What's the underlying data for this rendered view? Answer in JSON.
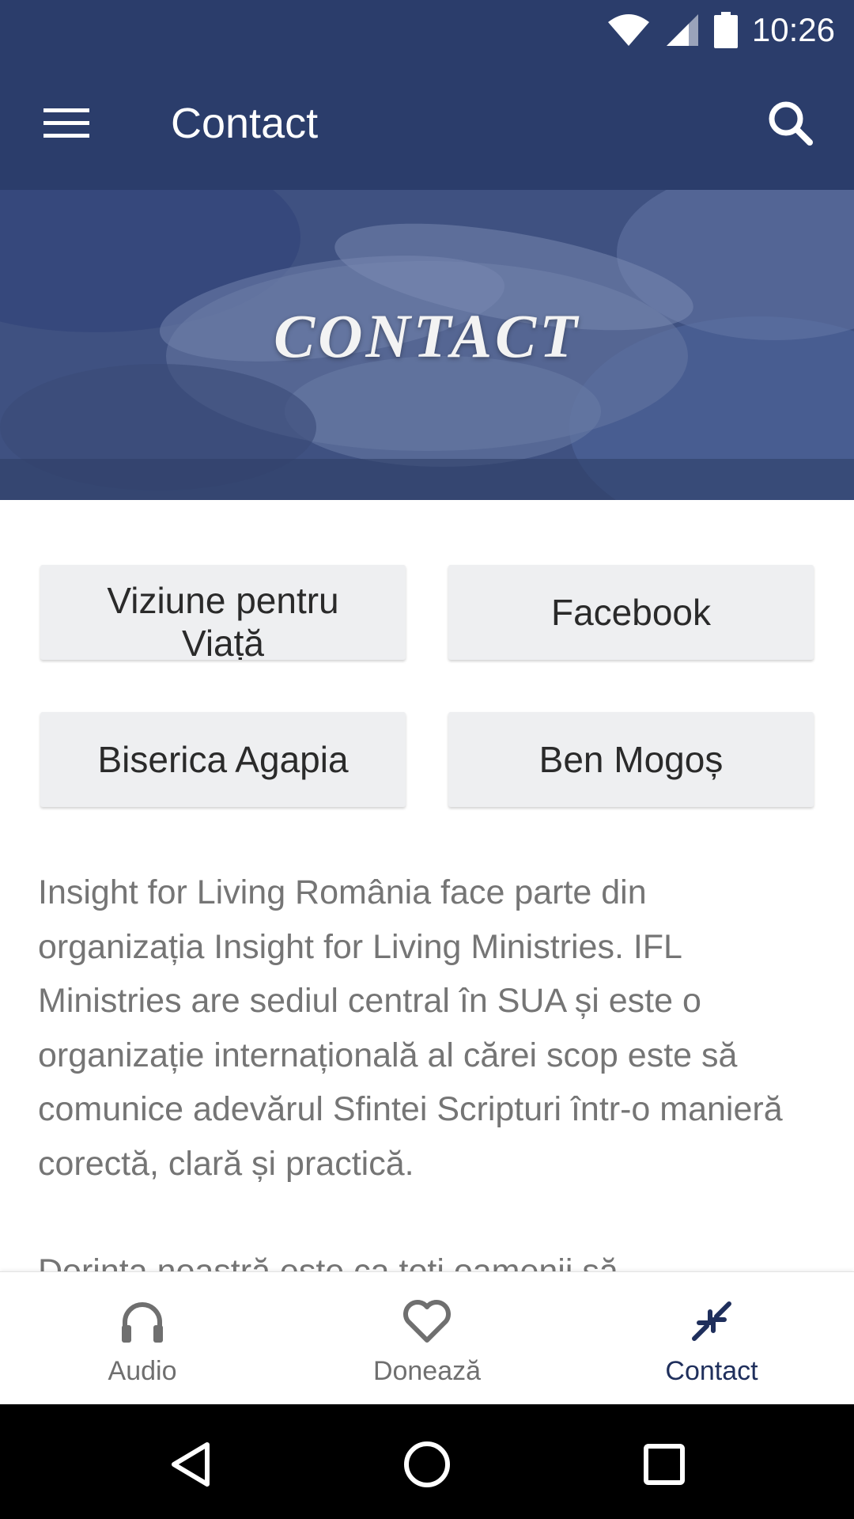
{
  "status_bar": {
    "time": "10:26"
  },
  "app_bar": {
    "title": "Contact"
  },
  "hero": {
    "title": "CONTACT"
  },
  "link_buttons": [
    {
      "label": "Viziune pentru Viață"
    },
    {
      "label": "Facebook"
    },
    {
      "label": "Biserica Agapia"
    },
    {
      "label": "Ben Mogoș"
    }
  ],
  "body": {
    "paragraph_1": "Insight for Living România face parte din organizația Insight for Living Ministries. IFL Ministries are sediul central în SUA și este o organizație internațională al cărei scop este să comunice adevărul Sfintei Scripturi într-o manieră corectă, clară și practică.",
    "paragraph_2": "Dorința noastră este ca toți oamenii să"
  },
  "bottom_nav": {
    "items": [
      {
        "label": "Audio",
        "icon": "headphones-icon",
        "active": false
      },
      {
        "label": "Donează",
        "icon": "heart-icon",
        "active": false
      },
      {
        "label": "Contact",
        "icon": "contact-arrows-icon",
        "active": true
      }
    ]
  },
  "colors": {
    "primary": "#2b3d6b",
    "active_nav": "#1f2f5c",
    "button_bg": "#eeeff1",
    "body_text": "#757575"
  }
}
